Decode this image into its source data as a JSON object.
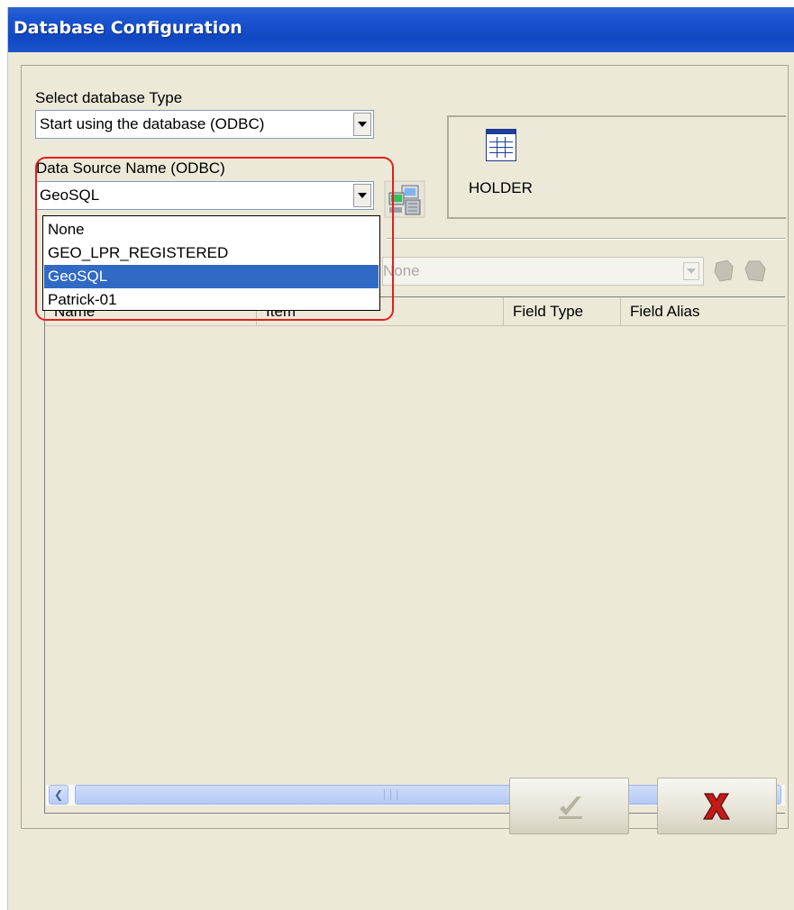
{
  "window": {
    "title": "Database Configuration"
  },
  "db_type": {
    "label": "Select database Type",
    "value": "Start using the database (ODBC)"
  },
  "dsn": {
    "label": "Data Source Name (ODBC)",
    "value": "GeoSQL",
    "options": [
      "None",
      "GEO_LPR_REGISTERED",
      "GeoSQL",
      "Patrick-01"
    ],
    "selected_index": 2
  },
  "holder": {
    "label": "HOLDER",
    "icon": "table-icon"
  },
  "table_combo": {
    "value": "None"
  },
  "table": {
    "columns": [
      "Name",
      "Item",
      "Field Type",
      "Field Alias"
    ]
  },
  "buttons": {
    "ok": {
      "icon": "checkmark-icon",
      "enabled": false
    },
    "cancel": {
      "icon": "x-icon",
      "color": "#c41a1a"
    }
  },
  "colors": {
    "titlebar": "#1148c2",
    "selection": "#316ac5",
    "highlight_ring": "#e81c1c",
    "window_bg": "#ECE9D8"
  }
}
